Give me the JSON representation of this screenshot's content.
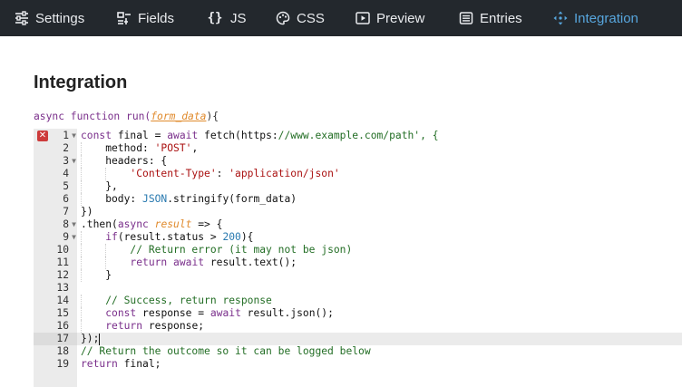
{
  "nav": {
    "tabs": [
      {
        "label": "Settings",
        "icon": "sliders-icon",
        "active": false
      },
      {
        "label": "Fields",
        "icon": "fields-icon",
        "active": false
      },
      {
        "label": "JS",
        "icon": "braces-icon",
        "active": false
      },
      {
        "label": "CSS",
        "icon": "palette-icon",
        "active": false
      },
      {
        "label": "Preview",
        "icon": "play-box-icon",
        "active": false
      },
      {
        "label": "Entries",
        "icon": "list-icon",
        "active": false
      },
      {
        "label": "Integration",
        "icon": "move-arrows-icon",
        "active": true
      }
    ]
  },
  "page": {
    "title": "Integration",
    "signature_keyword": "async function run(",
    "signature_param": "form_data",
    "signature_end": "){"
  },
  "editor": {
    "error_marker_line": 1,
    "active_line": 17,
    "lines": [
      {
        "num": "1",
        "fold": true,
        "text": "const final = await fetch('https://www.example.com/path', {"
      },
      {
        "num": "2",
        "fold": false,
        "text": "    method: 'POST',"
      },
      {
        "num": "3",
        "fold": true,
        "text": "    headers: {"
      },
      {
        "num": "4",
        "fold": false,
        "text": "        'Content-Type': 'application/json'"
      },
      {
        "num": "5",
        "fold": false,
        "text": "    },"
      },
      {
        "num": "6",
        "fold": false,
        "text": "    body: JSON.stringify(form_data)"
      },
      {
        "num": "7",
        "fold": false,
        "text": "})"
      },
      {
        "num": "8",
        "fold": true,
        "text": ".then(async result => {"
      },
      {
        "num": "9",
        "fold": true,
        "text": "    if(result.status > 200){"
      },
      {
        "num": "10",
        "fold": false,
        "text": "        // Return error (it may not be json)"
      },
      {
        "num": "11",
        "fold": false,
        "text": "        return await result.text();"
      },
      {
        "num": "12",
        "fold": false,
        "text": "    }"
      },
      {
        "num": "13",
        "fold": false,
        "text": ""
      },
      {
        "num": "14",
        "fold": false,
        "text": "    // Success, return response"
      },
      {
        "num": "15",
        "fold": false,
        "text": "    const response = await result.json();"
      },
      {
        "num": "16",
        "fold": false,
        "text": "    return response;"
      },
      {
        "num": "17",
        "fold": false,
        "text": "});"
      },
      {
        "num": "18",
        "fold": false,
        "text": "// Return the outcome so it can be logged below"
      },
      {
        "num": "19",
        "fold": false,
        "text": "return final;"
      }
    ]
  },
  "colors": {
    "topbar_bg": "#23282d",
    "tab_text": "#e9ebee",
    "tab_active": "#57a6dd",
    "keyword": "#7a2f8b",
    "string": "#a11",
    "comment": "#236e25",
    "builtin": "#2a7ab0",
    "param": "#e08a2c",
    "error_marker": "#cd3b3b"
  }
}
